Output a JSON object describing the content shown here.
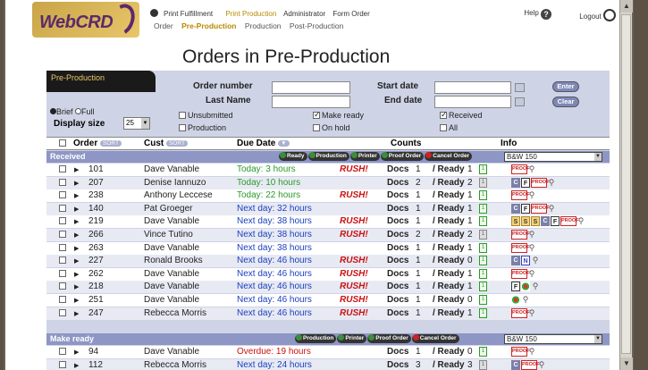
{
  "brand": {
    "name": "WebCRD"
  },
  "top_nav": [
    "Print Fulfillment",
    "Print Production",
    "Administrator",
    "Form Order"
  ],
  "sub_nav": [
    "Order",
    "Pre-Production",
    "Production",
    "Post-Production"
  ],
  "help_label": "Help",
  "logout_label": "Logout",
  "page_title": "Orders in Pre-Production",
  "panel_tab": "Pre-Production",
  "search": {
    "order_number_label": "Order number",
    "last_name_label": "Last Name",
    "start_date_label": "Start date",
    "end_date_label": "End date",
    "enter_label": "Enter",
    "clear_label": "Clear"
  },
  "view": {
    "brief": "Brief",
    "full": "Full",
    "display_size_label": "Display size",
    "display_size_value": "25"
  },
  "filters": {
    "unsubmitted": "Unsubmitted",
    "production": "Production",
    "make_ready": "Make ready",
    "on_hold": "On hold",
    "received": "Received",
    "all": "All"
  },
  "columns": {
    "order": "Order",
    "sort": "SORT",
    "cust": "Cust",
    "due_date": "Due Date",
    "counts": "Counts",
    "info": "Info"
  },
  "groups": {
    "received": {
      "label": "Received",
      "actions": [
        "Ready",
        "Production",
        "Printer",
        "Proof Order",
        "Cancel Order"
      ],
      "select": "B&W 150"
    },
    "make_ready": {
      "label": "Make ready",
      "actions": [
        "Production",
        "Printer",
        "Proof Order",
        "Cancel Order"
      ],
      "select": "B&W 150"
    }
  },
  "row_labels": {
    "docs": "Docs",
    "ready": "/ Ready",
    "rush": "RUSH!",
    "proof": "PROOF"
  },
  "received_rows": [
    {
      "order": "101",
      "cust": "Dave Vanable",
      "due": "Today: 3 hours",
      "rush": true,
      "docs": "1",
      "ready": "1"
    },
    {
      "order": "207",
      "cust": "Denise Iannuzo",
      "due": "Today: 10 hours",
      "rush": false,
      "docs": "2",
      "ready": "2"
    },
    {
      "order": "238",
      "cust": "Anthony Leccese",
      "due": "Today: 22 hours",
      "rush": true,
      "docs": "1",
      "ready": "1"
    },
    {
      "order": "140",
      "cust": "Pat Groeger",
      "due": "Next day: 32 hours",
      "rush": false,
      "docs": "1",
      "ready": "1"
    },
    {
      "order": "219",
      "cust": "Dave Vanable",
      "due": "Next day: 38 hours",
      "rush": true,
      "docs": "1",
      "ready": "1"
    },
    {
      "order": "266",
      "cust": "Vince Tutino",
      "due": "Next day: 38 hours",
      "rush": true,
      "docs": "2",
      "ready": "2"
    },
    {
      "order": "263",
      "cust": "Dave Vanable",
      "due": "Next day: 38 hours",
      "rush": false,
      "docs": "1",
      "ready": "1"
    },
    {
      "order": "227",
      "cust": "Ronald Brooks",
      "due": "Next day: 46 hours",
      "rush": true,
      "docs": "1",
      "ready": "0"
    },
    {
      "order": "262",
      "cust": "Dave Vanable",
      "due": "Next day: 46 hours",
      "rush": true,
      "docs": "1",
      "ready": "1"
    },
    {
      "order": "218",
      "cust": "Dave Vanable",
      "due": "Next day: 46 hours",
      "rush": true,
      "docs": "1",
      "ready": "1"
    },
    {
      "order": "251",
      "cust": "Dave Vanable",
      "due": "Next day: 46 hours",
      "rush": true,
      "docs": "1",
      "ready": "0"
    },
    {
      "order": "247",
      "cust": "Rebecca Morris",
      "due": "Next day: 46 hours",
      "rush": true,
      "docs": "1",
      "ready": "1"
    }
  ],
  "make_ready_rows": [
    {
      "order": "94",
      "cust": "Dave Vanable",
      "due": "Overdue: 19 hours",
      "rush": false,
      "docs": "1",
      "ready": "0"
    },
    {
      "order": "112",
      "cust": "Rebecca Morris",
      "due": "Next day: 24 hours",
      "rush": false,
      "docs": "3",
      "ready": "3"
    }
  ]
}
